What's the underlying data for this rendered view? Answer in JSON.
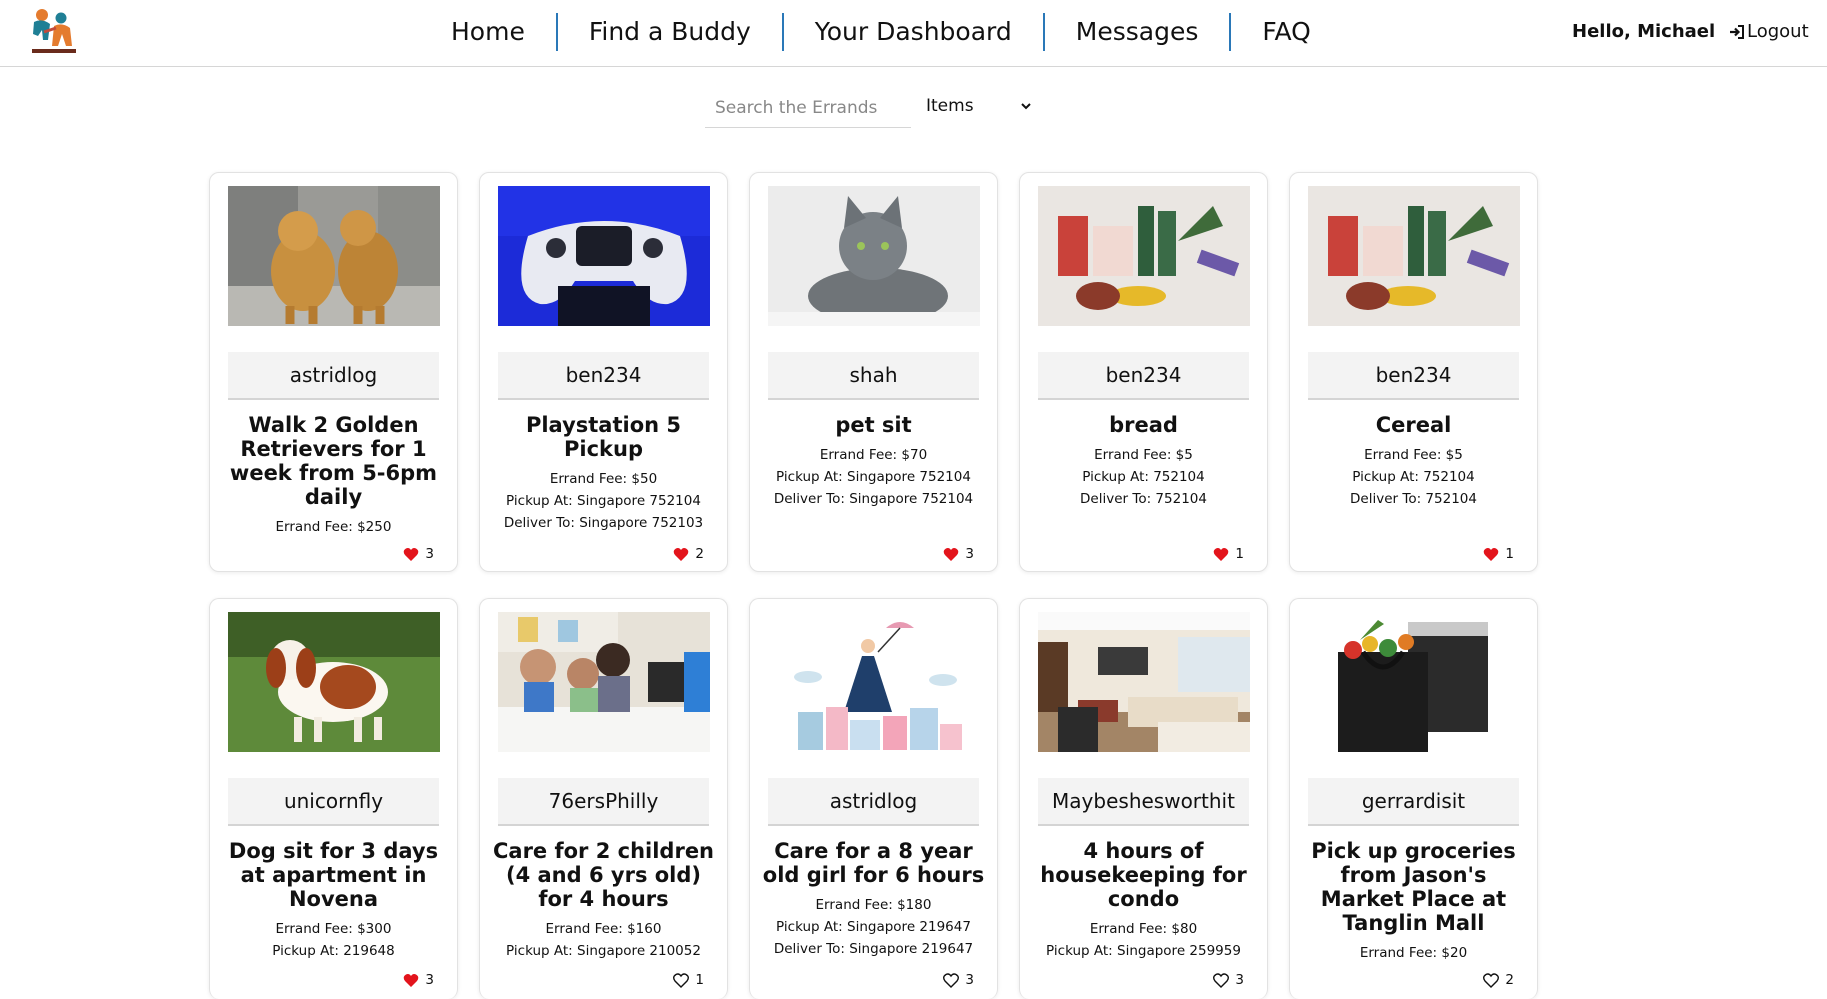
{
  "nav": {
    "items": [
      "Home",
      "Find a Buddy",
      "Your Dashboard",
      "Messages",
      "FAQ"
    ],
    "greeting": "Hello, Michael",
    "logout": "Logout"
  },
  "search": {
    "placeholder": "Search the Errands",
    "filter_value": "Items"
  },
  "errands": [
    {
      "user": "astridlog",
      "title": "Walk 2 Golden Retrievers for 1 week from 5-6pm daily",
      "fee": "Errand Fee: $250",
      "pickup": "",
      "deliver": "",
      "likes": "3",
      "liked": true,
      "image": "golden-retrievers"
    },
    {
      "user": "ben234",
      "title": "Playstation 5 Pickup",
      "fee": "Errand Fee: $50",
      "pickup": "Pickup At: Singapore 752104",
      "deliver": "Deliver To: Singapore 752103",
      "likes": "2",
      "liked": true,
      "image": "ps5-controller"
    },
    {
      "user": "shah",
      "title": "pet sit",
      "fee": "Errand Fee: $70",
      "pickup": "Pickup At: Singapore 752104",
      "deliver": "Deliver To: Singapore 752104",
      "likes": "3",
      "liked": true,
      "image": "grey-cat"
    },
    {
      "user": "ben234",
      "title": "bread",
      "fee": "Errand Fee: $5",
      "pickup": "Pickup At: 752104",
      "deliver": "Deliver To: 752104",
      "likes": "1",
      "liked": true,
      "image": "groceries"
    },
    {
      "user": "ben234",
      "title": "Cereal",
      "fee": "Errand Fee: $5",
      "pickup": "Pickup At: 752104",
      "deliver": "Deliver To: 752104",
      "likes": "1",
      "liked": true,
      "image": "groceries"
    },
    {
      "user": "unicornfly",
      "title": "Dog sit for 3 days at apartment in Novena",
      "fee": "Errand Fee: $300",
      "pickup": "Pickup At: 219648",
      "deliver": "",
      "likes": "3",
      "liked": true,
      "image": "spaniel"
    },
    {
      "user": "76ersPhilly",
      "title": "Care for 2 children (4 and 6 yrs old) for 4 hours",
      "fee": "Errand Fee: $160",
      "pickup": "Pickup At: Singapore 210052",
      "deliver": "",
      "likes": "1",
      "liked": false,
      "image": "children"
    },
    {
      "user": "astridlog",
      "title": "Care for a 8 year old girl for 6 hours",
      "fee": "Errand Fee: $180",
      "pickup": "Pickup At: Singapore 219647",
      "deliver": "Deliver To: Singapore 219647",
      "likes": "3",
      "liked": false,
      "image": "nanny-umbrella"
    },
    {
      "user": "Maybeshesworthit",
      "title": "4 hours of housekeeping for condo",
      "fee": "Errand Fee: $80",
      "pickup": "Pickup At: Singapore 259959",
      "deliver": "",
      "likes": "3",
      "liked": false,
      "image": "living-room"
    },
    {
      "user": "gerrardisit",
      "title": "Pick up groceries from Jason's Market Place at Tanglin Mall",
      "fee": "Errand Fee: $20",
      "pickup": "",
      "deliver": "",
      "likes": "2",
      "liked": false,
      "image": "grocery-bags"
    }
  ],
  "colors": {
    "heart": "#e3141c",
    "nav_separator": "#2a78b8",
    "username_bg": "#f3f3f3"
  }
}
